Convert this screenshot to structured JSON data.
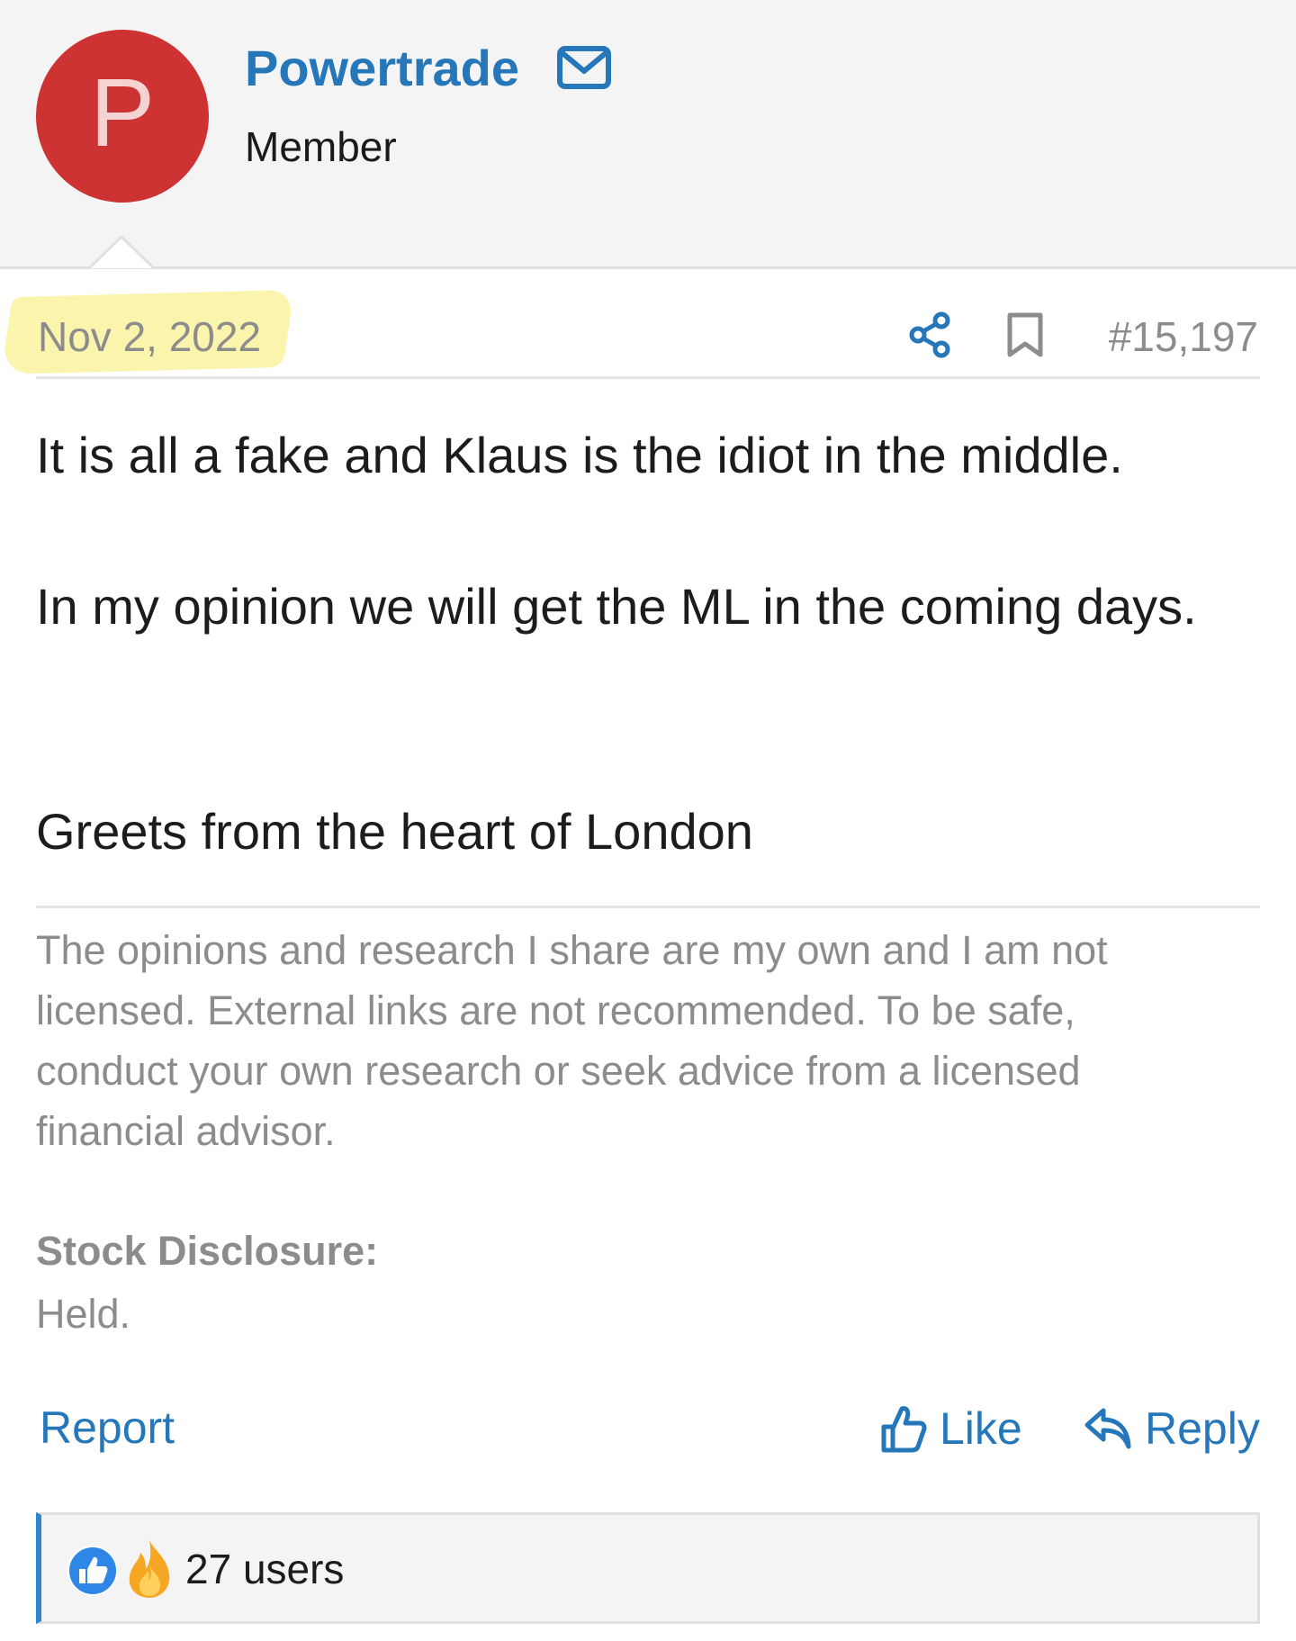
{
  "post": {
    "author": {
      "avatar_letter": "P",
      "avatar_color": "#cd3333",
      "username": "Powertrade",
      "user_title": "Member"
    },
    "meta": {
      "date": "Nov 2, 2022",
      "post_number": "#15,197",
      "highlight_color": "#faf3a8"
    },
    "body": {
      "paragraphs": [
        "It is all a fake and Klaus is the idiot in the middle.",
        "In my opinion we will get the ML in the coming days.",
        "Greets from the heart of London"
      ]
    },
    "signature": {
      "text": "The opinions and research I share are my own and I am not licensed. External links are not recommended. To be safe, conduct your own research or seek advice from a licensed financial advisor.",
      "disclosure_label": "Stock Disclosure:",
      "disclosure_value": "Held."
    },
    "actions": {
      "report_label": "Report",
      "like_label": "Like",
      "reply_label": "Reply"
    },
    "reactions": {
      "icons": [
        "like-reaction-icon",
        "fire-reaction-icon"
      ],
      "summary": "27 users"
    }
  },
  "colors": {
    "link": "#2577b9",
    "reaction_bar_accent": "#2e86d1"
  }
}
